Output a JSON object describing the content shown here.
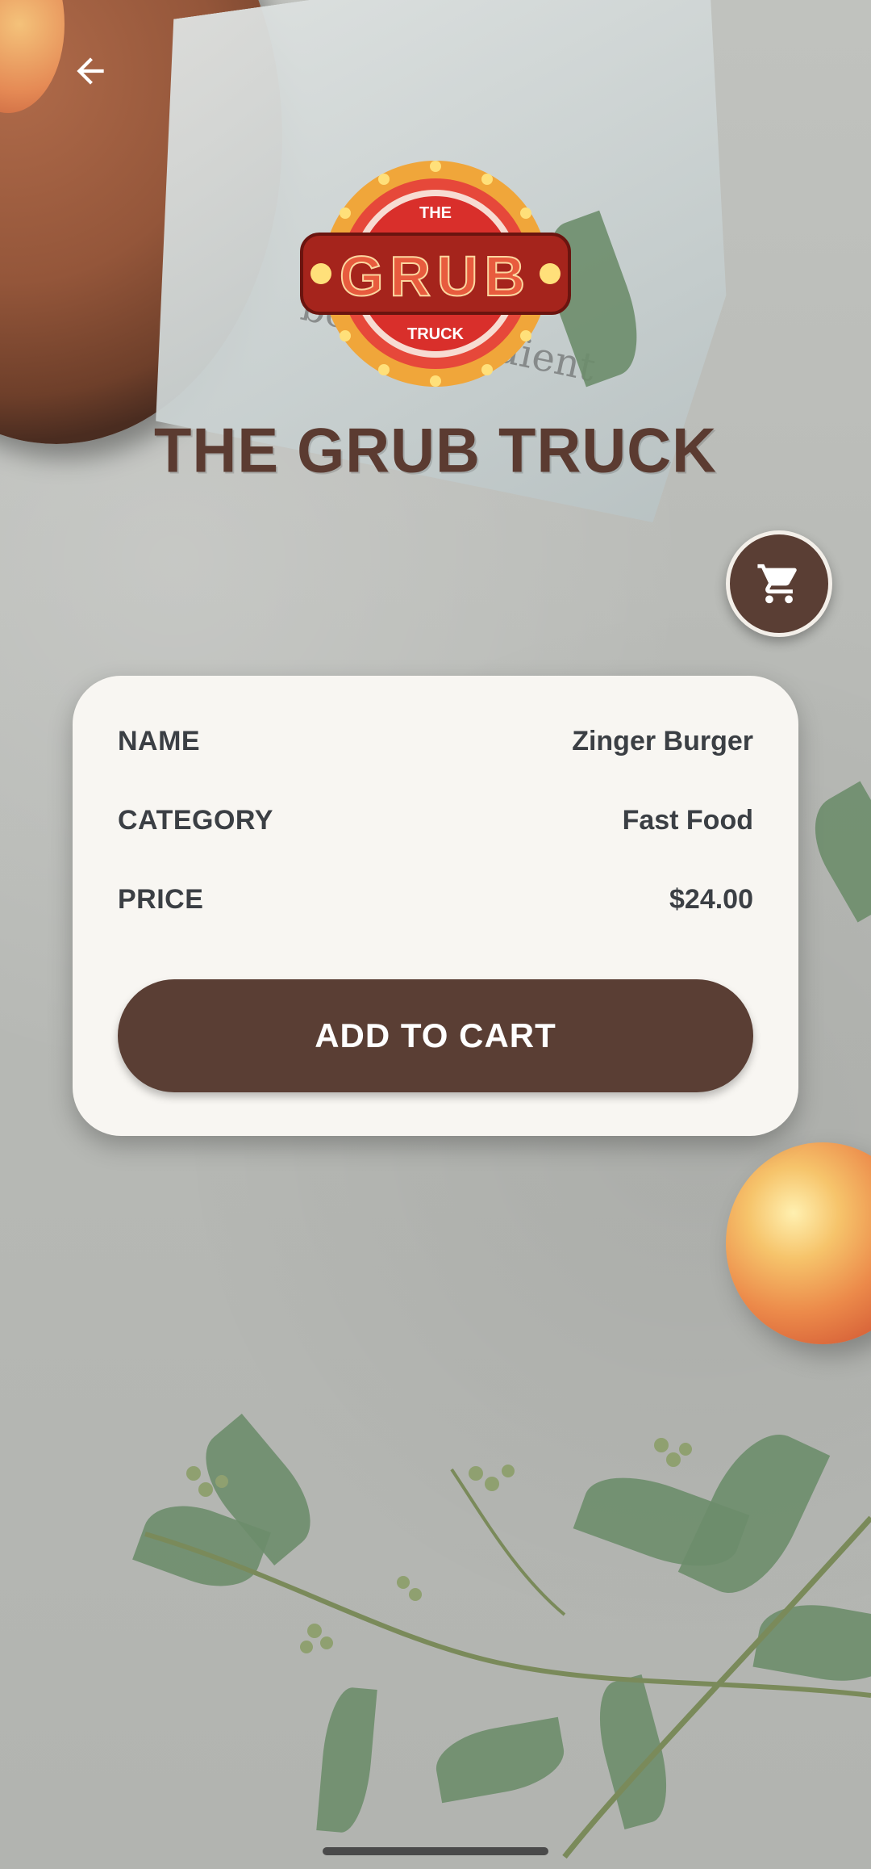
{
  "header": {
    "back_icon": "arrow-left-icon",
    "app_title": "THE GRUB TRUCK"
  },
  "logo": {
    "top_text": "THE",
    "main_text": "GRUB",
    "bottom_text": "TRUCK"
  },
  "cart_button": {
    "icon": "cart-icon"
  },
  "product": {
    "name_label": "NAME",
    "name_value": "Zinger Burger",
    "category_label": "CATEGORY",
    "category_value": "Fast Food",
    "price_label": "PRICE",
    "price_value": "$24.00"
  },
  "actions": {
    "add_to_cart": "ADD TO CART"
  },
  "background": {
    "cloth_text": "best ingredient"
  },
  "colors": {
    "brand_brown": "#5a3e34",
    "card_bg": "#f8f6f2",
    "text_dark": "#3b3f44"
  }
}
